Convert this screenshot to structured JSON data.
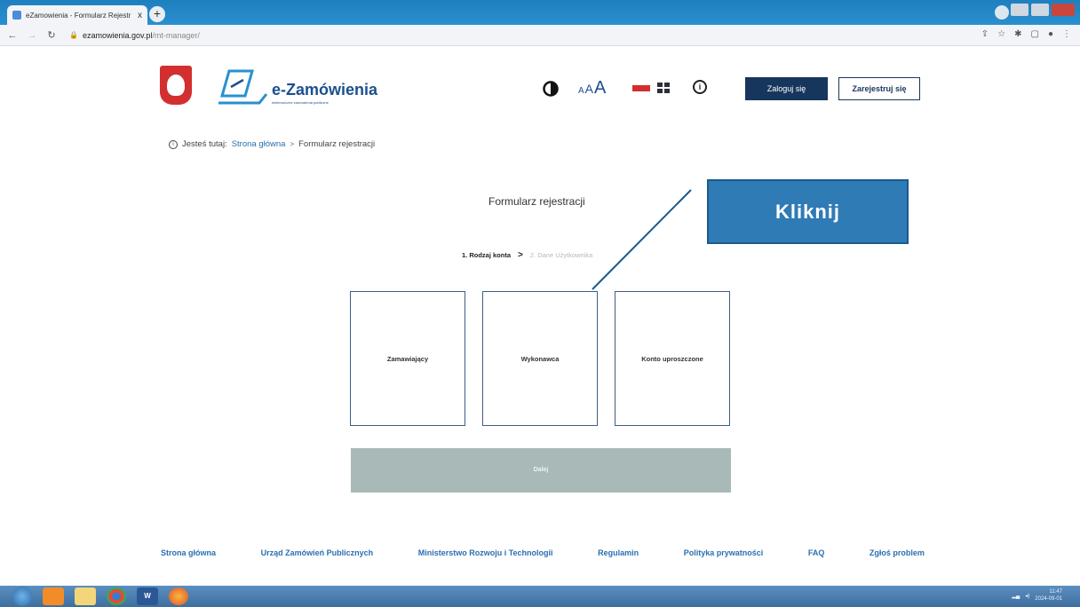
{
  "browser": {
    "tab_title": "eZamowienia - Formularz Rejestr",
    "tab_close": "x",
    "new_tab": "+",
    "url_host": "ezamowienia.gov.pl",
    "url_path": "/mt-manager/"
  },
  "header": {
    "logo_text": "e-Zamówienia",
    "logo_subtitle": "elektroniczne zamówienia publiczne",
    "font_small": "A",
    "font_medium": "A",
    "font_large": "A",
    "info_glyph": "i",
    "login_label": "Zaloguj się",
    "register_label": "Zarejestruj się"
  },
  "breadcrumb": {
    "prefix": "Jesteś tutaj:",
    "home": "Strona główna",
    "separator": ">",
    "current": "Formularz rejestracji"
  },
  "form": {
    "title": "Formularz rejestracji",
    "step1": "1. Rodzaj konta",
    "step_separator": ">",
    "step2": "2. Dane Użytkownika",
    "cards": [
      "Zamawiający",
      "Wykonawca",
      "Konto uproszczone"
    ],
    "next_label": "Dalej"
  },
  "annotation": {
    "label": "Kliknij"
  },
  "footer": {
    "links": [
      "Strona główna",
      "Urząd Zamówień Publicznych",
      "Ministerstwo Rozwoju i Technologii",
      "Regulamin",
      "Polityka prywatności",
      "FAQ",
      "Zgłoś problem"
    ]
  },
  "taskbar": {
    "word_label": "W",
    "time": "11:47",
    "date": "2024-09-01"
  },
  "colors": {
    "brand_navy": "#17365d",
    "brand_blue": "#1d4f8f",
    "link_blue": "#2a6fb0",
    "callout_blue": "#2f7bb5",
    "next_disabled": "#a9b9b8",
    "emblem_red": "#d32f2f"
  }
}
